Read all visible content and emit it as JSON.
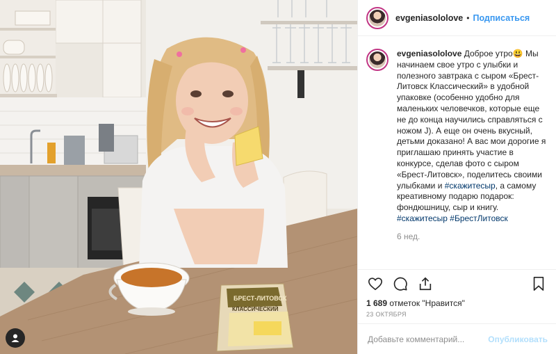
{
  "post": {
    "username": "evgeniasololove",
    "follow_label": "Подписаться",
    "separator": "•",
    "caption_lines": {
      "intro": "Доброе утро😃",
      "body": "Мы начинаем свое утро с улыбки и полезного завтрака с сыром «Брест-Литовск Классический» в удобной упаковке (особенно удобно для маленьких человечков, которые еще не до конца научились справляться с ножом J). А еще он очень вкусный, детьми доказано! А вас мои дорогие я приглашаю принять участие в конкурсе, сделав фото с сыром «Брест-Литовск», поделитесь своими улыбками и ",
      "tag_inline": "#скажитесыр",
      "body_end": ", а самому креативному подарю подарок: фондюшницу, сыр и книгу.",
      "tag_1": "#скажитесыр",
      "tag_2": "#БрестЛитовск"
    },
    "time_ago": "6 нед.",
    "likes_count": "1 689",
    "likes_label": "отметок \"Нравится\"",
    "date": "23 ОКТЯБРЯ",
    "comment_placeholder": "Добавьте комментарий...",
    "publish_label": "Опубликовать",
    "package_label": "КЛАССИЧЕСКИЙ",
    "package_brand": "БРЕСТ-ЛИТОВСК"
  },
  "colors": {
    "link_blue": "#3897f0",
    "hashtag": "#00376b",
    "muted": "#8e8e8e",
    "publish_disabled": "#b2dffc",
    "story_ring": "#c13584"
  },
  "icons": [
    "heart-icon",
    "comment-icon",
    "share-icon",
    "bookmark-icon",
    "user-tag-icon",
    "more-icon"
  ]
}
